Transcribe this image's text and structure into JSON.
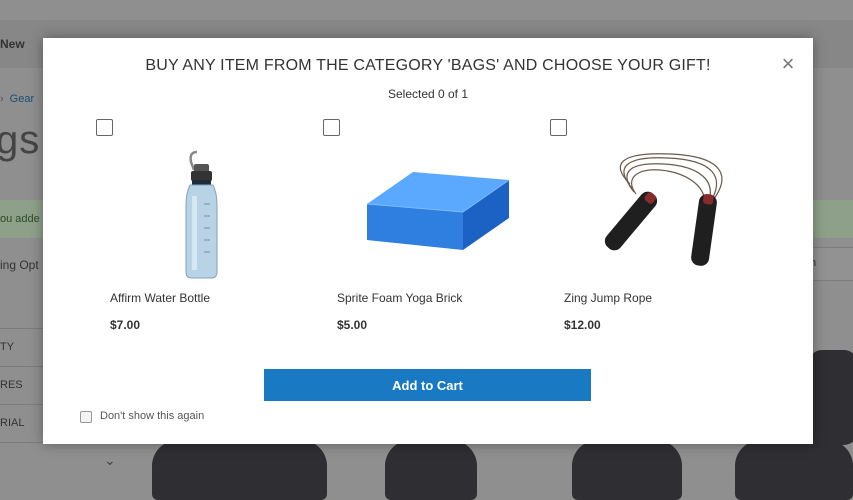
{
  "background": {
    "top_link": "New",
    "breadcrumb": {
      "separator": "›",
      "link": "Gear"
    },
    "page_title": "gs",
    "message": "ou adde",
    "options_label": "ing Opt",
    "sorter_text": "n",
    "filters": [
      "TY",
      "RES",
      "RIAL"
    ]
  },
  "modal": {
    "title": "BUY ANY ITEM FROM THE CATEGORY 'BAGS' AND CHOOSE YOUR GIFT!",
    "subtitle": "Selected 0 of 1",
    "close_icon": "close-icon",
    "close_glyph": "×",
    "products": [
      {
        "name": "Affirm Water Bottle",
        "price": "$7.00",
        "icon": "water-bottle-image",
        "selected": false
      },
      {
        "name": "Sprite Foam Yoga Brick",
        "price": "$5.00",
        "icon": "yoga-brick-image",
        "selected": false
      },
      {
        "name": "Zing Jump Rope",
        "price": "$12.00",
        "icon": "jump-rope-image",
        "selected": false
      }
    ],
    "add_to_cart_label": "Add to Cart",
    "dont_show_label": "Don't show this again"
  },
  "colors": {
    "overlay": "#8f8f8f",
    "button": "#1979c3",
    "brick": "#2f7fe0"
  }
}
